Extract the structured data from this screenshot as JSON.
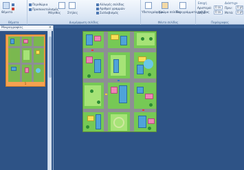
{
  "ribbon": {
    "groups": [
      {
        "label": "Θέματα"
      },
      {
        "label": "Διαμόρφωση σελίδας"
      },
      {
        "label": "Φόντο σελίδας"
      },
      {
        "label": "Παράγραφος"
      }
    ],
    "buttons": {
      "themes": "Θέματα",
      "margins": "Περιθώρια",
      "orientation": "Προσανατολισμός",
      "size": "Μέγεθος",
      "columns": "Στήλες",
      "breaks": "Αλλαγές σελίδας",
      "line_numbers": "Αριθμοί γραμμών",
      "hyphenation": "Συλλαβισμός",
      "watermark": "Υδατογράφημα",
      "page_color": "Χρώμα σελίδας",
      "page_borders": "Περιγράμματα σελίδας",
      "indent_label": "Εσοχή",
      "spacing_label": "Διάστιχο",
      "left_label": "Αριστερά:",
      "right_label": "Δεξιά:",
      "before_label": "Πριν:",
      "after_label": "Μετά:",
      "indent_left_value": "0 εκ.",
      "indent_right_value": "0 εκ.",
      "before_value": "0 pt",
      "after_value": "0 pt"
    }
  },
  "nav_pane": {
    "title": "Μικρογραφίες",
    "page_number": "1"
  }
}
